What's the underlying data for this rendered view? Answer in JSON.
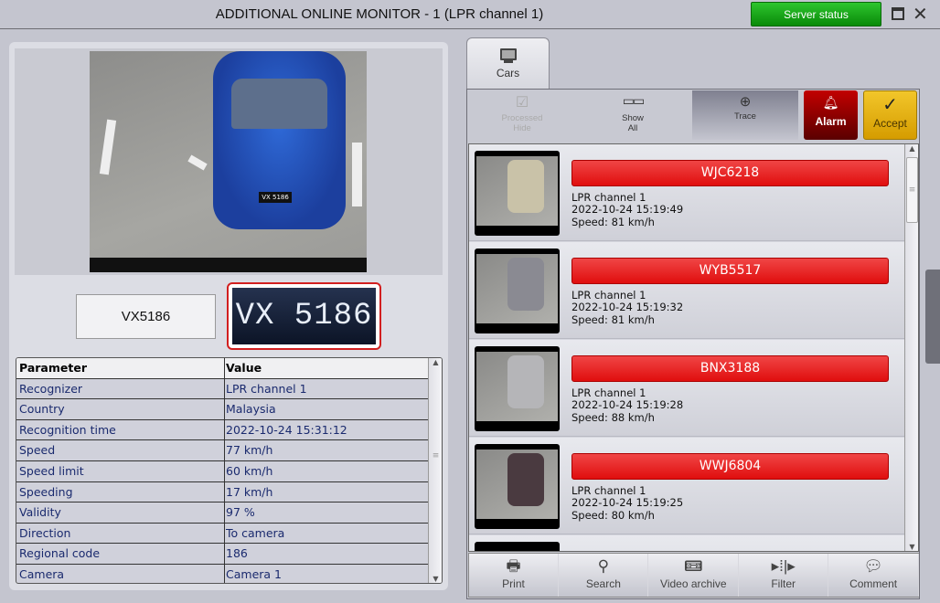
{
  "window": {
    "title": "ADDITIONAL ONLINE MONITOR - 1  (LPR channel  1)",
    "server_status": "Server status",
    "colors": {
      "server_status": "#15a815",
      "plate_bar": "#e81b1b",
      "alarm": "#a30000",
      "accept": "#e8b10a"
    }
  },
  "left": {
    "plate_text": "VX5186",
    "plate_crop_text": "VX 5186",
    "car_plate_small": "VX 5186",
    "table": {
      "headers": [
        "Parameter",
        "Value"
      ],
      "rows": [
        [
          "Recognizer",
          "LPR channel  1"
        ],
        [
          "Country",
          "Malaysia"
        ],
        [
          "Recognition time",
          "2022-10-24 15:31:12"
        ],
        [
          "Speed",
          "77 km/h"
        ],
        [
          "Speed limit",
          "60 km/h"
        ],
        [
          "Speeding",
          "17 km/h"
        ],
        [
          "Validity",
          "97 %"
        ],
        [
          "Direction",
          "To camera"
        ],
        [
          "Regional code",
          "186"
        ],
        [
          "Camera",
          "Camera 1"
        ]
      ]
    }
  },
  "right": {
    "tab": {
      "label": "Cars",
      "icon": "monitor-icon"
    },
    "toolbar": {
      "processed_hide": [
        "Processed",
        "Hide"
      ],
      "show_all": [
        "Show",
        "All"
      ],
      "trace": "Trace",
      "alarm": "Alarm",
      "accept": "Accept"
    },
    "items": [
      {
        "plate": "WJC6218",
        "channel": "LPR channel  1",
        "time": "2022-10-24 15:19:49",
        "speed": "Speed: 81 km/h",
        "car_color": "#c9c2a8"
      },
      {
        "plate": "WYB5517",
        "channel": "LPR channel  1",
        "time": "2022-10-24 15:19:32",
        "speed": "Speed: 81 km/h",
        "car_color": "#8a8a92"
      },
      {
        "plate": "BNX3188",
        "channel": "LPR channel  1",
        "time": "2022-10-24 15:19:28",
        "speed": "Speed: 88 km/h",
        "car_color": "#b5b5b8"
      },
      {
        "plate": "WWJ6804",
        "channel": "LPR channel  1",
        "time": "2022-10-24 15:19:25",
        "speed": "Speed: 80 km/h",
        "car_color": "#4a3a40"
      }
    ],
    "bottom": [
      {
        "label": "Print",
        "icon": "printer-icon"
      },
      {
        "label": "Search",
        "icon": "search-icon"
      },
      {
        "label": "Video archive",
        "icon": "video-archive-icon"
      },
      {
        "label": "Filter",
        "icon": "filter-icon"
      },
      {
        "label": "Comment",
        "icon": "comment-icon"
      }
    ]
  }
}
